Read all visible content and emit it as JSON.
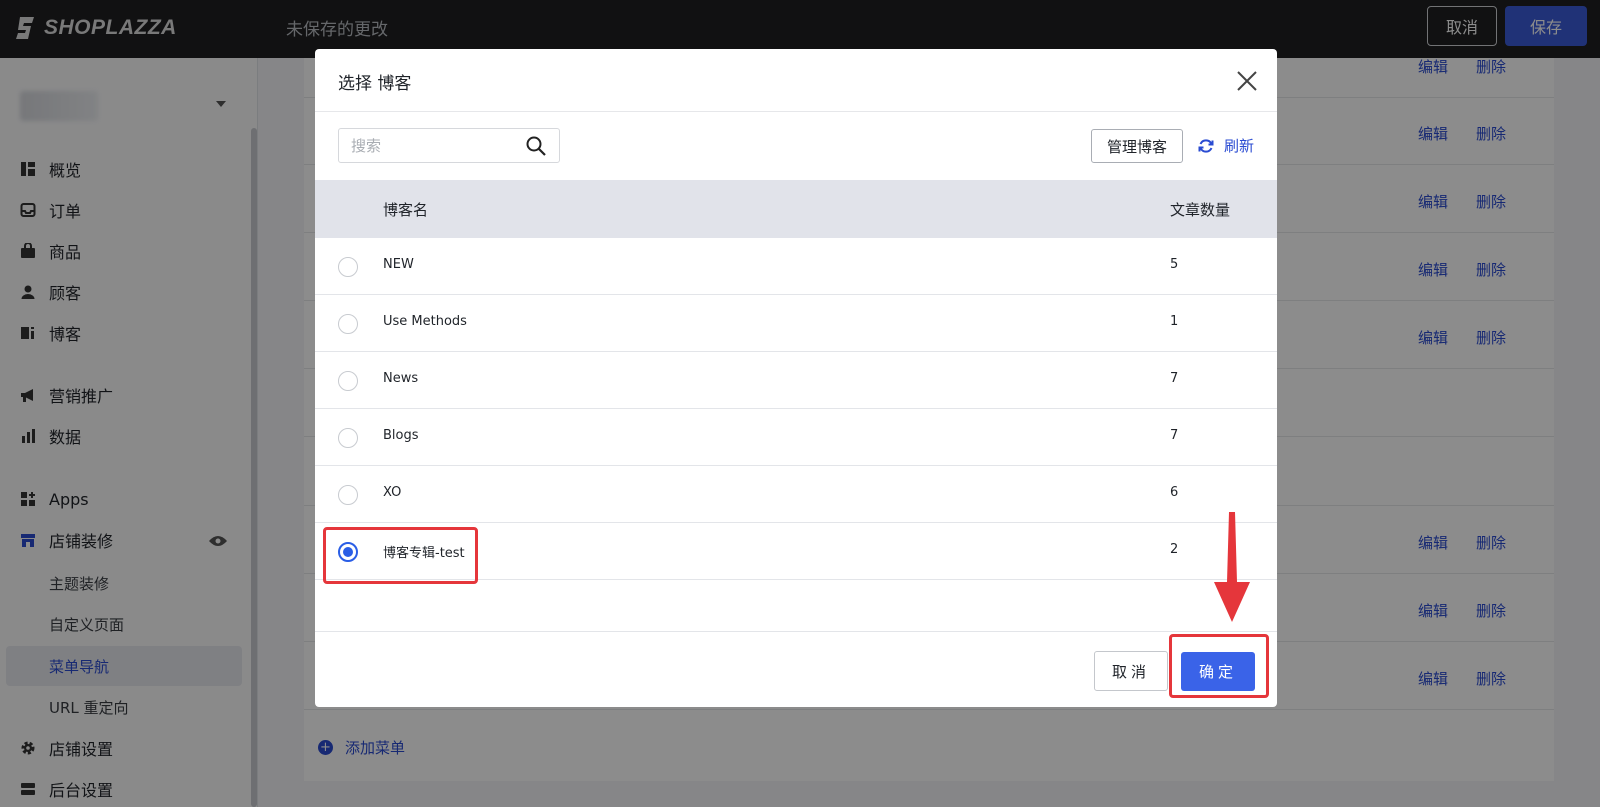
{
  "topbar": {
    "brand": "SHOPLAZZA",
    "status": "未保存的更改",
    "cancel_label": "取消",
    "save_label": "保存"
  },
  "sidebar": {
    "items": [
      {
        "label": "概览",
        "icon": "dashboard-icon"
      },
      {
        "label": "订单",
        "icon": "inbox-icon"
      },
      {
        "label": "商品",
        "icon": "bag-icon"
      },
      {
        "label": "顾客",
        "icon": "user-icon"
      },
      {
        "label": "博客",
        "icon": "blog-icon"
      },
      {
        "label": "营销推广",
        "icon": "megaphone-icon"
      },
      {
        "label": "数据",
        "icon": "bar-chart-icon"
      },
      {
        "label": "Apps",
        "icon": "apps-icon"
      },
      {
        "label": "店铺装修",
        "icon": "store-icon"
      },
      {
        "label": "店铺设置",
        "icon": "gear-icon"
      },
      {
        "label": "后台设置",
        "icon": "server-icon"
      }
    ],
    "subitems": [
      {
        "label": "主题装修"
      },
      {
        "label": "自定义页面"
      },
      {
        "label": "菜单导航",
        "active": true
      },
      {
        "label": "URL 重定向"
      }
    ]
  },
  "background": {
    "edit_label": "编辑",
    "delete_label": "删除",
    "add_menu_label": "添加菜单"
  },
  "modal": {
    "title": "选择 博客",
    "search_placeholder": "搜索",
    "manage_label": "管理博客",
    "refresh_label": "刷新",
    "columns": {
      "name": "博客名",
      "count": "文章数量"
    },
    "rows": [
      {
        "name": "NEW",
        "count": "5",
        "selected": false
      },
      {
        "name": "Use Methods",
        "count": "1",
        "selected": false
      },
      {
        "name": "News",
        "count": "7",
        "selected": false
      },
      {
        "name": "Blogs",
        "count": "7",
        "selected": false
      },
      {
        "name": "XO",
        "count": "6",
        "selected": false
      },
      {
        "name": "博客专辑-test",
        "count": "2",
        "selected": true
      }
    ],
    "cancel_label": "取消",
    "ok_label": "确定"
  },
  "colors": {
    "primary": "#3a63e8",
    "link": "#2a4bd2",
    "annotation": "#e5363b",
    "topbar": "#1f2022"
  }
}
